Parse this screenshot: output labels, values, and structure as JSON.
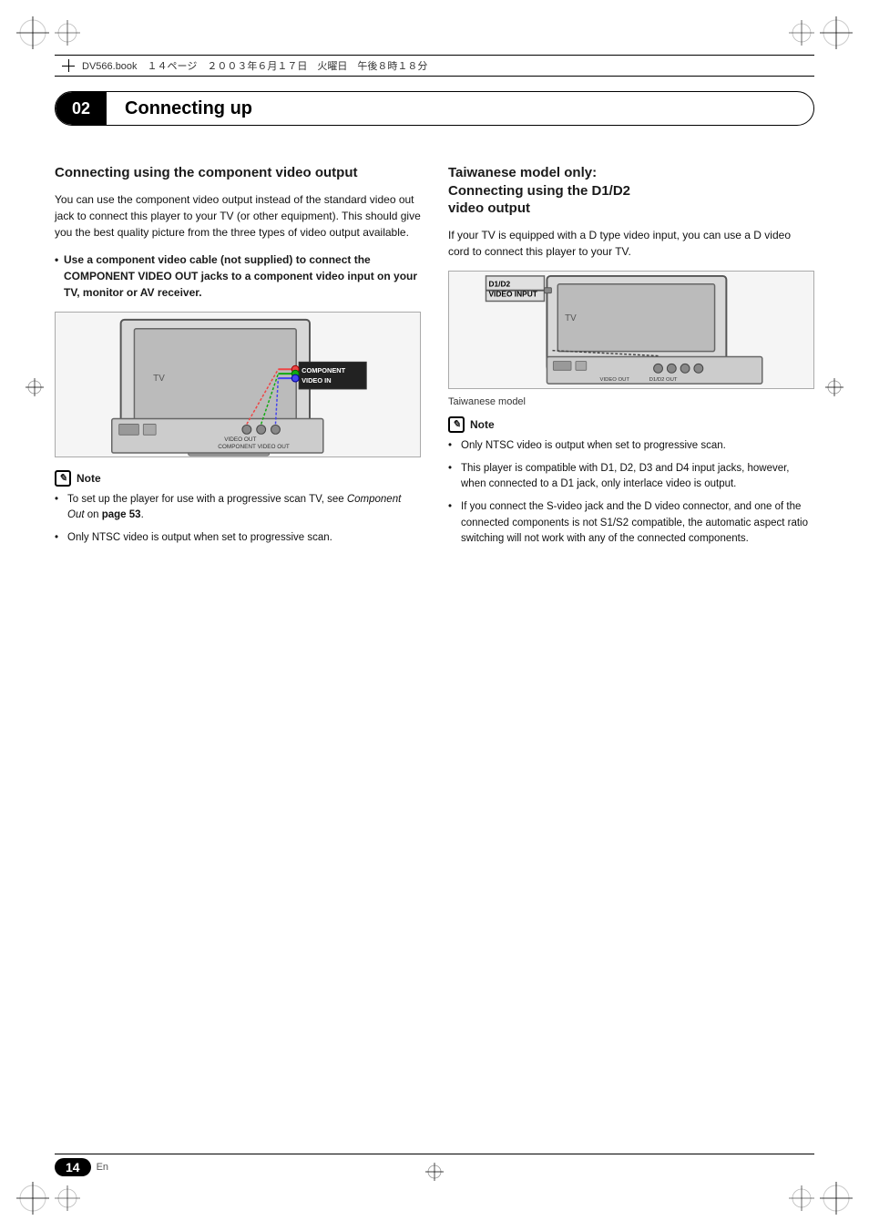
{
  "meta": {
    "file_info": "DV566.book　１４ページ　２００３年６月１７日　火曜日　午後８時１８分"
  },
  "chapter": {
    "number": "02",
    "title": "Connecting up"
  },
  "left_section": {
    "title": "Connecting using the component video output",
    "body": "You can use the component video output instead of the standard video out jack to connect this player to your TV (or other equipment). This should give you the best quality picture from the three types of video output available.",
    "bullet": "Use a component video cable (not supplied) to connect the COMPONENT VIDEO OUT jacks to a component video input on your TV, monitor or AV receiver.",
    "diagram_label": "COMPONENT\nVIDEO IN",
    "diagram_tv_label": "TV",
    "note_header": "Note",
    "notes": [
      "To set up the player for use with a progressive scan TV, see Component Out on page 53.",
      "Only NTSC video is output when set to progressive scan."
    ],
    "note_page_ref": "page 53",
    "note_component_out": "Component Out"
  },
  "right_section": {
    "title": "Taiwanese model only:\nConnecting using the D1/D2 video output",
    "body": "If your TV is equipped with a D type video input, you can use a D video cord to connect this player to your TV.",
    "diagram_label": "D1/D2\nVIDEO INPUT",
    "diagram_tv_label": "TV",
    "tw_model_label": "Taiwanese model",
    "note_header": "Note",
    "notes": [
      "Only NTSC video is output when set to progressive scan.",
      "This player is compatible with D1, D2, D3 and D4 input jacks, however, when connected to a D1 jack, only interlace video is output.",
      "If you connect the S-video jack and the D video connector, and one of the connected components is not S1/S2 compatible, the automatic aspect ratio switching will not work with any of the connected components."
    ]
  },
  "footer": {
    "page_number": "14",
    "lang": "En"
  }
}
